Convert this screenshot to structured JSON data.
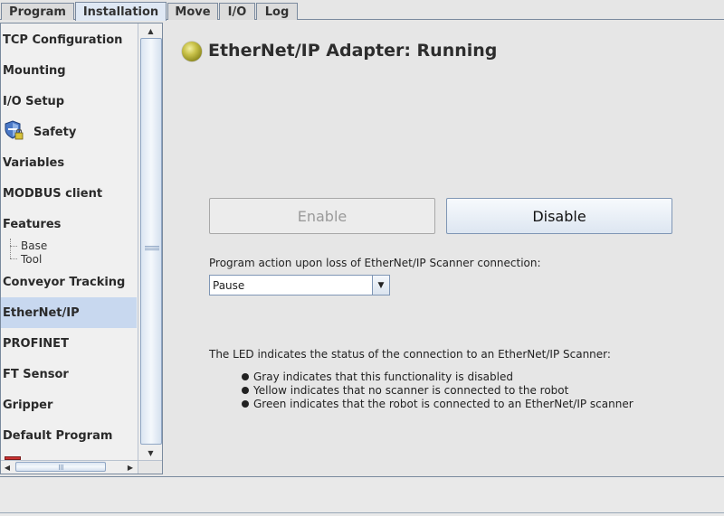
{
  "tabs": [
    {
      "label": "Program"
    },
    {
      "label": "Installation"
    },
    {
      "label": "Move"
    },
    {
      "label": "I/O"
    },
    {
      "label": "Log"
    }
  ],
  "sidebar": {
    "items": [
      {
        "label": "TCP Configuration"
      },
      {
        "label": "Mounting"
      },
      {
        "label": "I/O Setup"
      },
      {
        "label": "Safety",
        "icon": "shield-lock-icon"
      },
      {
        "label": "Variables"
      },
      {
        "label": "MODBUS client"
      },
      {
        "label": "Features"
      },
      {
        "label": "Conveyor Tracking"
      },
      {
        "label": "EtherNet/IP"
      },
      {
        "label": "PROFINET"
      },
      {
        "label": "FT Sensor"
      },
      {
        "label": "Gripper"
      },
      {
        "label": "Default Program"
      }
    ],
    "feature_children": [
      {
        "label": "Base"
      },
      {
        "label": "Tool"
      }
    ],
    "selected": "EtherNet/IP"
  },
  "main": {
    "status_title": "EtherNet/IP Adapter: Running",
    "led_color": "#c9c24a",
    "enable_label": "Enable",
    "disable_label": "Disable",
    "action_label": "Program action upon loss of EtherNet/IP Scanner connection:",
    "action_value": "Pause",
    "led_info": "The LED indicates the status of the connection to an EtherNet/IP Scanner:",
    "bullets": [
      "Gray indicates that this functionality is disabled",
      "Yellow indicates that no scanner is connected to the robot",
      "Green indicates that the robot is connected to an EtherNet/IP scanner"
    ]
  }
}
